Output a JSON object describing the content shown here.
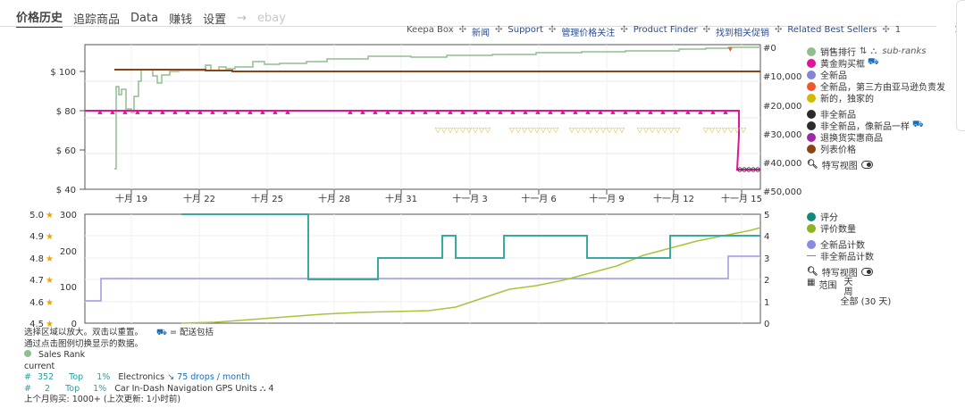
{
  "tabs": [
    {
      "label": "价格历史",
      "active": true
    },
    {
      "label": "追踪商品"
    },
    {
      "label": "Data"
    },
    {
      "label": "赚钱"
    },
    {
      "label": "设置"
    },
    {
      "label": "ebay",
      "disabled": true
    }
  ],
  "links": [
    "Keepa Box",
    "新闻",
    "Support",
    "管理价格关注",
    "Product Finder",
    "找到相关促销",
    "Related Best Sellers",
    "1",
    "1"
  ],
  "top_chart": {
    "y_left_ticks": [
      "$ 100",
      "$ 80",
      "$ 60",
      "$ 40"
    ],
    "y_right_ticks": [
      "#0",
      "#10,000",
      "#20,000",
      "#30,000",
      "#40,000",
      "#50,000"
    ],
    "x_ticks": [
      "十月 19",
      "十月 22",
      "十月 25",
      "十月 28",
      "十月 31",
      "十一月 3",
      "十一月 6",
      "十一月 9",
      "十一月 12",
      "十一月 15"
    ]
  },
  "legend_top": {
    "items": [
      {
        "label": "销售排行",
        "color": "#8fbf8f",
        "sub": "sub-ranks"
      },
      {
        "label": "黄金购买框",
        "color": "#e0139b",
        "truck": true
      },
      {
        "label": "全新品",
        "color": "#8484d6"
      },
      {
        "label": "全新品，第三方由亚马逊负责发",
        "color": "#f0562b"
      },
      {
        "label": "新的，独家的",
        "color": "#d4b800"
      },
      {
        "label": "非全新品",
        "color": "#2b2b2b",
        "gap": true
      },
      {
        "label": "非全新品，像新品一样",
        "color": "#2b2b2b",
        "truck": true
      },
      {
        "label": "退换货实惠商品",
        "color": "#9c2aa7"
      },
      {
        "label": "列表价格",
        "color": "#8b4513"
      }
    ],
    "zoom_label": "特写视图"
  },
  "bottom_chart": {
    "star_ticks": [
      "5.0",
      "4.9",
      "4.8",
      "4.7",
      "4.6",
      "4.5"
    ],
    "count_ticks": [
      "300",
      "200",
      "100",
      "0"
    ],
    "right_ticks": [
      "5",
      "4",
      "3",
      "2",
      "1",
      "0"
    ]
  },
  "legend_bottom": {
    "items": [
      {
        "label": "评分",
        "color": "#0d8a7d"
      },
      {
        "label": "评价数量",
        "color": "#8db31f"
      },
      {
        "label": "全新品计数",
        "color": "#8a8ae0",
        "gap": true
      },
      {
        "label": "非全新品计数",
        "color": "#888888",
        "dash": true
      }
    ],
    "zoom_label": "特写视图",
    "range_label": "范围",
    "range_options": [
      "天",
      "周",
      "全部 (30 天)"
    ]
  },
  "footer": {
    "hint_line1": "选择区域以放大。双击以重置。",
    "hint_shipping": "= 配送包括",
    "hint_line2": "通过点击图例切换显示的数据。",
    "sales_rank_label": "Sales Rank",
    "current_label": "current",
    "rank_rows": [
      {
        "hash": "#",
        "rank": "352",
        "top": "Top",
        "pct": "1%",
        "category": "Electronics",
        "drops": "75 drops / month"
      },
      {
        "hash": "#",
        "rank": "2",
        "top": "Top",
        "pct": "1%",
        "category": "Car In-Dash Navigation GPS Units",
        "subcount": "4"
      }
    ],
    "last_line": "上个月购买: 1000+ (上次更新: 1小时前)"
  },
  "colors": {
    "sales_rank": "#8fbf8f",
    "buybox": "#e0139b",
    "new": "#8484d6",
    "fba": "#f0562b",
    "exclusive": "#d4b800",
    "list_price": "#8b4513",
    "rating": "#3aa9a0",
    "review_count": "#a4c639",
    "new_count": "#9a9ae6"
  }
}
